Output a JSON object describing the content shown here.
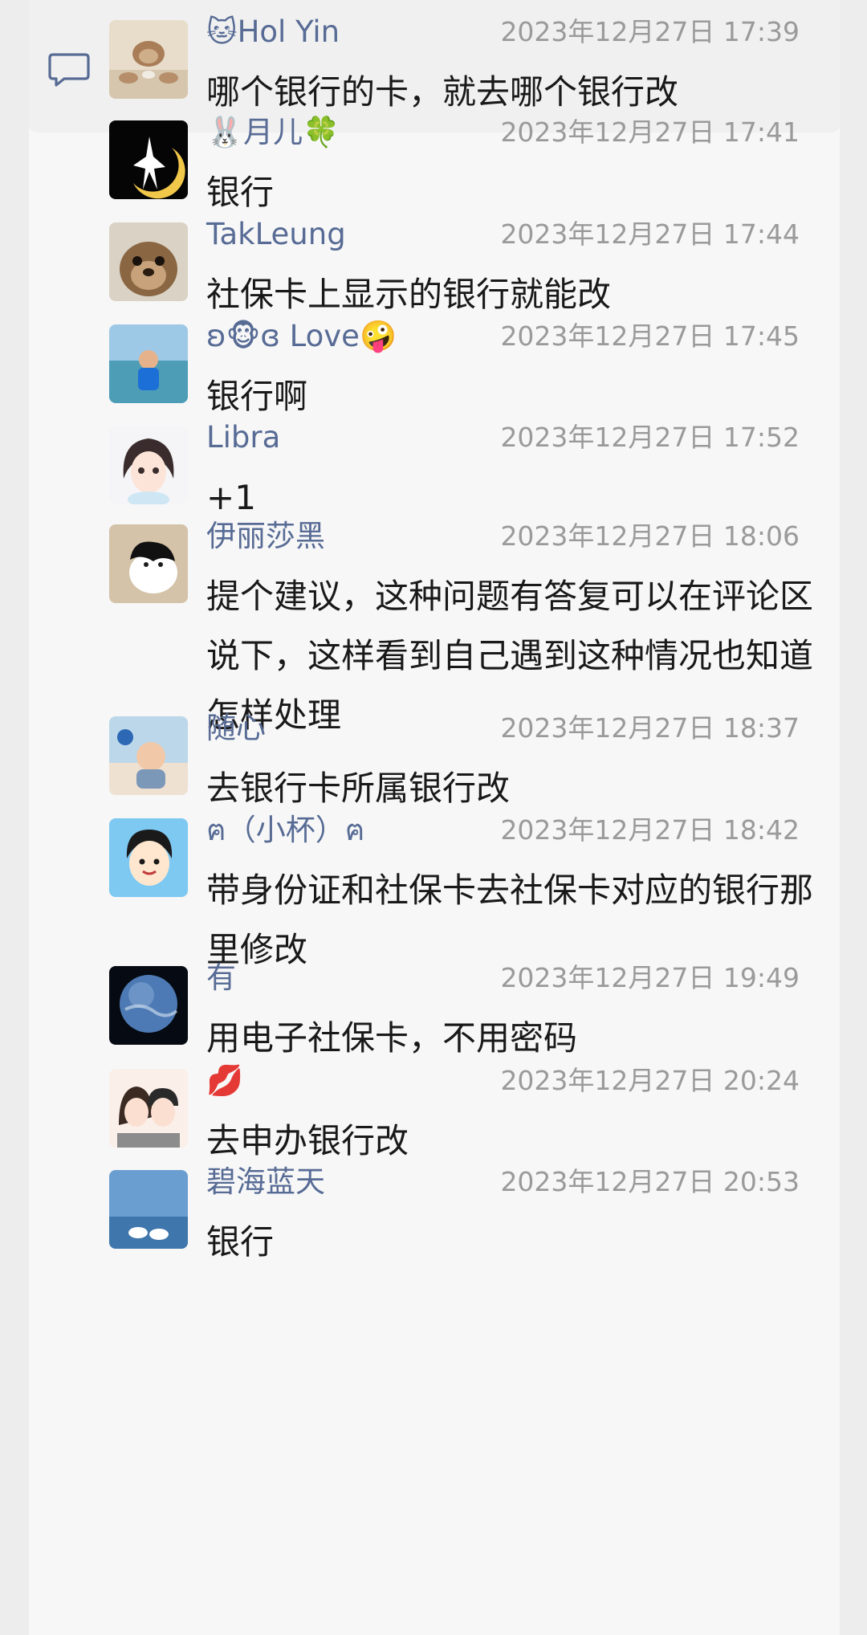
{
  "comments": [
    {
      "name": "🐱Hol Yin",
      "time": "2023年12月27日 17:39",
      "text": "哪个银行的卡，就去哪个银行改"
    },
    {
      "name": "🐰月儿🍀",
      "time": "2023年12月27日 17:41",
      "text": "银行"
    },
    {
      "name": "TakLeung",
      "time": "2023年12月27日 17:44",
      "text": "社保卡上显示的银行就能改"
    },
    {
      "name": "ʚ🐵ɞ Love🤪",
      "time": "2023年12月27日 17:45",
      "text": "银行啊"
    },
    {
      "name": "Libra",
      "time": "2023年12月27日 17:52",
      "text": "+1"
    },
    {
      "name": "伊丽莎黑",
      "time": "2023年12月27日 18:06",
      "text": "提个建议，这种问题有答复可以在评论区说下，这样看到自己遇到这种情况也知道怎样处理"
    },
    {
      "name": "随心",
      "time": "2023年12月27日 18:37",
      "text": "去银行卡所属银行改"
    },
    {
      "name": "ฅ（小杯）ฅ",
      "time": "2023年12月27日 18:42",
      "text": "带身份证和社保卡去社保卡对应的银行那里修改"
    },
    {
      "name": "有",
      "time": "2023年12月27日 19:49",
      "text": "用电子社保卡，不用密码"
    },
    {
      "name": "💋",
      "time": "2023年12月27日 20:24",
      "text": "去申办银行改"
    },
    {
      "name": "碧海蓝天",
      "time": "2023年12月27日 20:53",
      "text": "银行"
    }
  ],
  "colors": {
    "name": "#576b95",
    "time": "#9a9a9a",
    "text": "#191919",
    "background": "#f7f7f7"
  },
  "icons": {
    "comment": "comment-bubble-icon"
  }
}
